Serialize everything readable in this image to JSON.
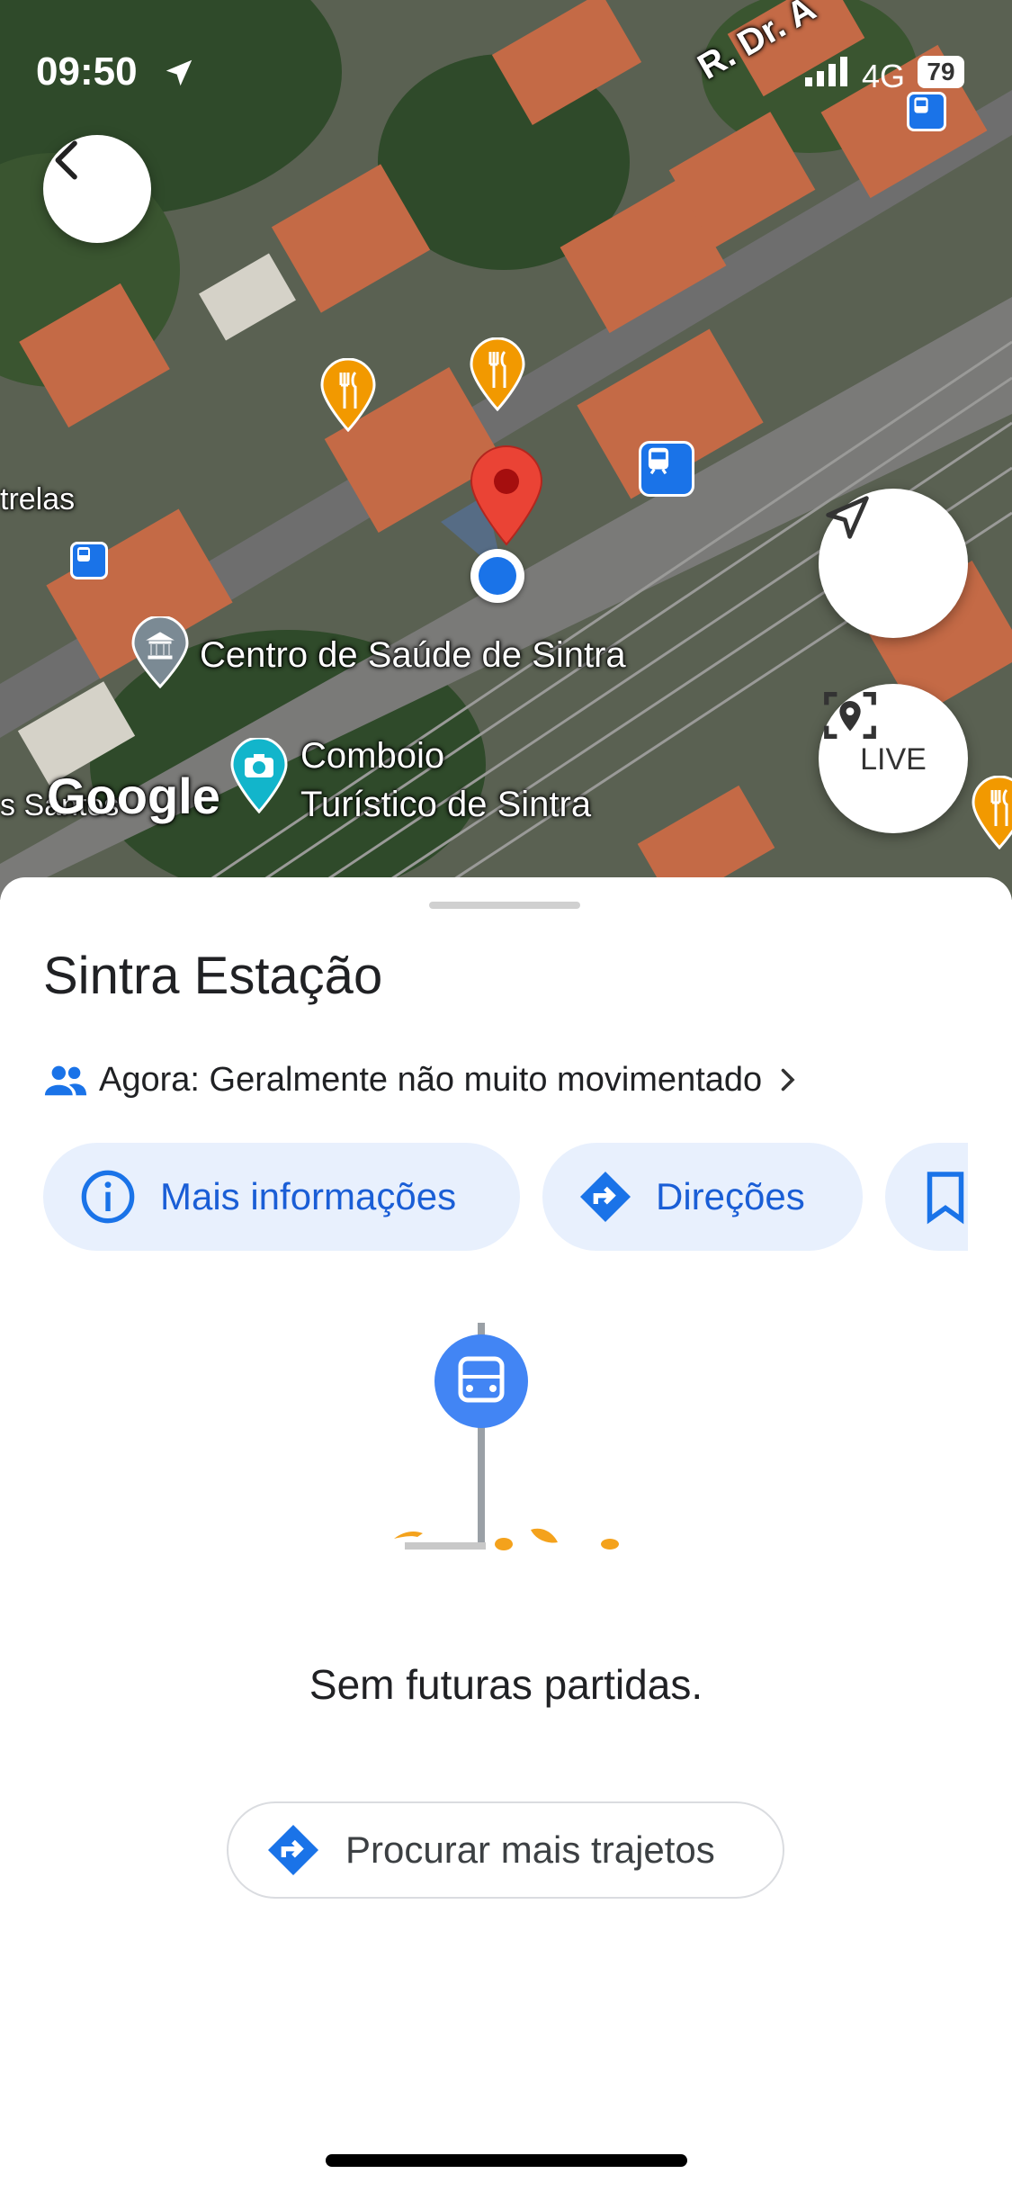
{
  "status_bar": {
    "time": "09:50",
    "network": "4G",
    "battery": "79"
  },
  "map": {
    "street_label": "R. Dr. A",
    "labels": {
      "health_center": "Centro de Saúde de Sintra",
      "tourist_train_line1": "Comboio",
      "tourist_train_line2": "Turístico de Sintra",
      "estrelas": "trelas",
      "santos": "s Santos",
      "watermark": "Google"
    },
    "live_label": "LIVE"
  },
  "sheet": {
    "title": "Sintra Estação",
    "busyness": "Agora: Geralmente não muito movimentado",
    "chips": {
      "info": "Mais informações",
      "directions": "Direções"
    },
    "empty_message": "Sem futuras partidas.",
    "search_button": "Procurar mais trajetos"
  },
  "colors": {
    "accent": "#1a73e8",
    "chip_bg": "#e8f0fd",
    "pin_red": "#ea4335",
    "restaurant": "#f29900",
    "transit": "#1a73e8",
    "leaf": "#f4a21c"
  }
}
